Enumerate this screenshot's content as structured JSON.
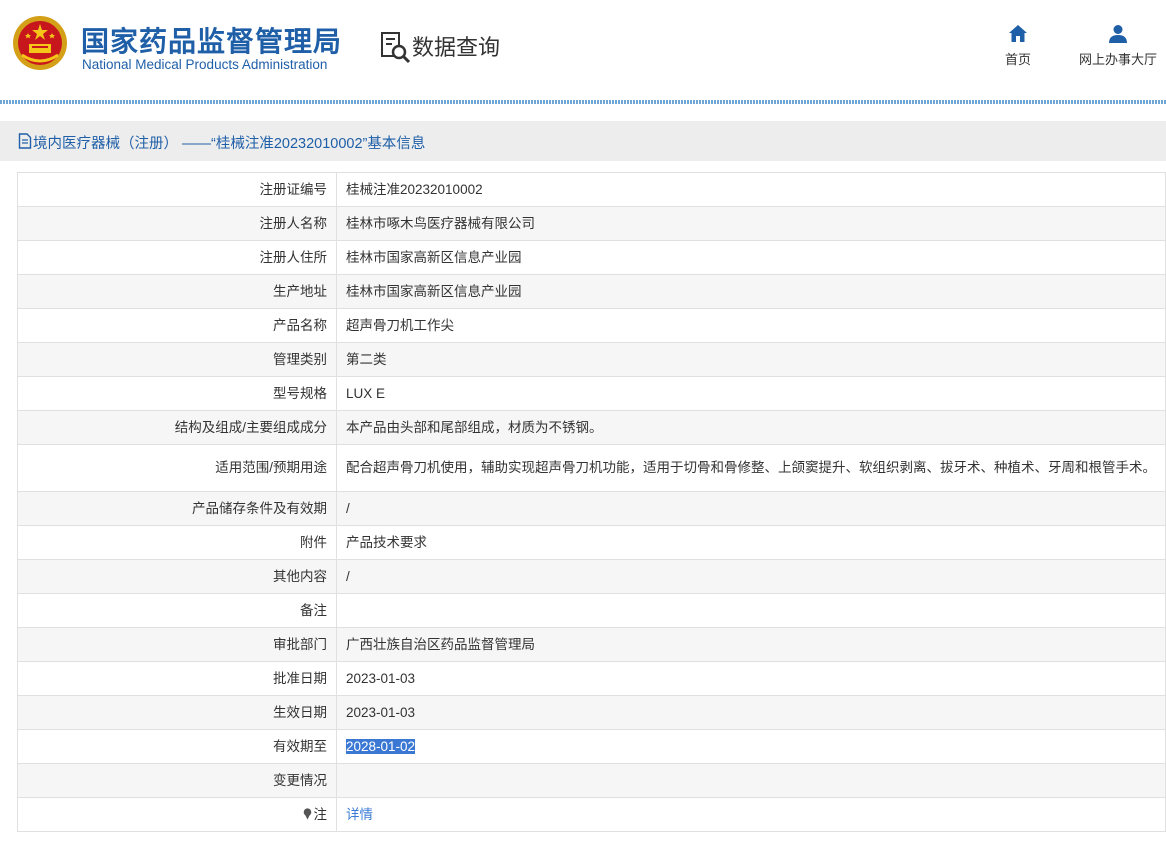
{
  "header": {
    "org_cn": "国家药品监督管理局",
    "org_en": "National Medical Products Administration",
    "section_title": "数据查询",
    "nav": [
      {
        "label": "首页",
        "icon": "home-icon"
      },
      {
        "label": "网上办事大厅",
        "icon": "user-icon"
      }
    ]
  },
  "record": {
    "title": "境内医疗器械（注册） ——“桂械注准20232010002”基本信息",
    "rows": [
      {
        "label": "注册证编号",
        "value": "桂械注准20232010002"
      },
      {
        "label": "注册人名称",
        "value": "桂林市啄木鸟医疗器械有限公司"
      },
      {
        "label": "注册人住所",
        "value": "桂林市国家高新区信息产业园"
      },
      {
        "label": "生产地址",
        "value": "桂林市国家高新区信息产业园"
      },
      {
        "label": "产品名称",
        "value": "超声骨刀机工作尖"
      },
      {
        "label": "管理类别",
        "value": "第二类"
      },
      {
        "label": "型号规格",
        "value": "LUX E"
      },
      {
        "label": "结构及组成/主要组成成分",
        "value": "本产品由头部和尾部组成，材质为不锈钢。"
      },
      {
        "label": "适用范围/预期用途",
        "value": "配合超声骨刀机使用，辅助实现超声骨刀机功能，适用于切骨和骨修整、上颌窦提升、软组织剥离、拔牙术、种植术、牙周和根管手术。"
      },
      {
        "label": "产品储存条件及有效期",
        "value": "/"
      },
      {
        "label": "附件",
        "value": "产品技术要求"
      },
      {
        "label": "其他内容",
        "value": "/"
      },
      {
        "label": "备注",
        "value": ""
      },
      {
        "label": "审批部门",
        "value": "广西壮族自治区药品监督管理局"
      },
      {
        "label": "批准日期",
        "value": "2023-01-03"
      },
      {
        "label": "生效日期",
        "value": "2023-01-03"
      },
      {
        "label": "有效期至",
        "value": "2028-01-02"
      },
      {
        "label": "变更情况",
        "value": ""
      },
      {
        "label": "注",
        "value": "详情"
      }
    ]
  },
  "colors": {
    "brand_blue": "#1f5fa8",
    "link_blue": "#3a7bd5",
    "selection": "#3a78d4"
  }
}
